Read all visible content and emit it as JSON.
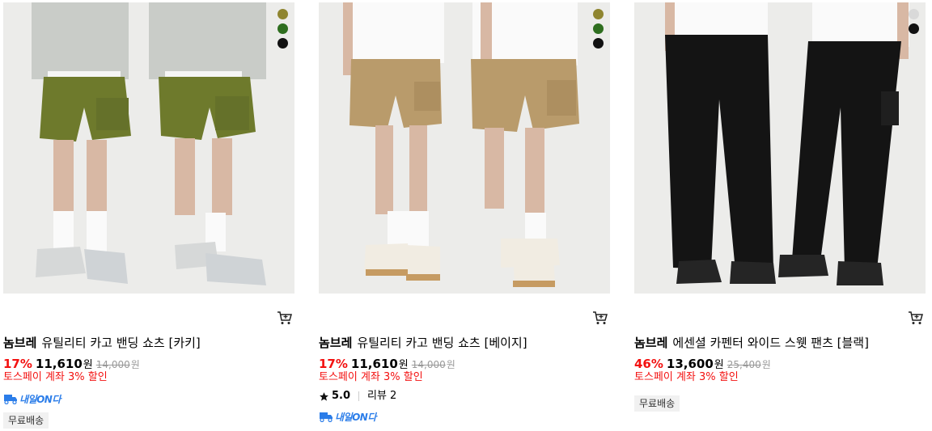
{
  "products": [
    {
      "brand": "놈브레",
      "name": "유틸리티 카고 밴딩 쇼츠 [카키]",
      "discount": "17%",
      "price": "11,610",
      "currency": "원",
      "original_price": "14,000",
      "promo": "토스페이 계좌 3% 할인",
      "delivery_badge": "내일ON다",
      "tag": "무료배송",
      "swatches": [
        "#8f8530",
        "#2e6e1f",
        "#111111"
      ]
    },
    {
      "brand": "놈브레",
      "name": "유틸리티 카고 밴딩 쇼츠 [베이지]",
      "discount": "17%",
      "price": "11,610",
      "currency": "원",
      "original_price": "14,000",
      "promo": "토스페이 계좌 3% 할인",
      "rating": "5.0",
      "review_label": "리뷰",
      "review_count": "2",
      "delivery_badge": "내일ON다",
      "swatches": [
        "#8f8530",
        "#2e6e1f",
        "#111111"
      ]
    },
    {
      "brand": "놈브레",
      "name": "에센셜 카펜터 와이드 스웻 팬츠 [블랙]",
      "discount": "46%",
      "price": "13,600",
      "currency": "원",
      "original_price": "25,400",
      "promo": "토스페이 계좌 3% 할인",
      "tag": "무료배송",
      "swatches": [
        "#d9d9d9",
        "#111111"
      ]
    }
  ],
  "colors": {
    "discount": "#f31110",
    "delivery": "#2b7de9"
  },
  "icons": {
    "cart": "cart-icon",
    "star": "star-icon",
    "delivery": "delivery-truck-icon"
  }
}
